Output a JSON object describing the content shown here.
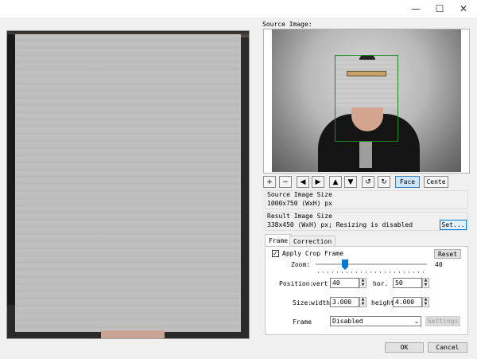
{
  "window": {
    "minimize_glyph": "—",
    "maximize_glyph": "☐",
    "close_glyph": "✕"
  },
  "source_image": {
    "label": "Source Image:"
  },
  "toolbar": {
    "zoom_in": "+",
    "zoom_out": "−",
    "move_left": "◀",
    "move_right": "▶",
    "move_up": "▲",
    "move_down": "▼",
    "rotate_left": "↺",
    "rotate_right": "↻",
    "face_label": "Face",
    "center_label": "Cente"
  },
  "source_size": {
    "label": "Source Image Size",
    "value": "1000x750 (WxH) px"
  },
  "result_size": {
    "label": "Result Image Size",
    "value": "338x450 (WxH) px; Resizing is disabled",
    "set_label": "Set..."
  },
  "tabs": [
    {
      "label": "Frame",
      "active": true
    },
    {
      "label": "Correction",
      "active": false
    }
  ],
  "frame": {
    "apply_crop_label": "Apply Crop Frame",
    "apply_crop_checked": true,
    "check_glyph": "✓",
    "reset_label": "Reset",
    "zoom_label": "Zoom:",
    "zoom_value": "40",
    "position_label": "Position:",
    "vert_label": "vert",
    "vert_value": "40",
    "hor_label": "hor.",
    "hor_value": "50",
    "size_label": "Size:",
    "width_label": "width",
    "width_value": "3.000",
    "height_label": "height",
    "height_value": "4.000",
    "frame_label": "Frame",
    "frame_select_value": "Disabled",
    "settings_label": "Settings"
  },
  "dialog": {
    "ok_label": "OK",
    "cancel_label": "Cancel"
  },
  "icons": {
    "spin_up": "▲",
    "spin_down": "▼",
    "dropdown": "⌄"
  }
}
